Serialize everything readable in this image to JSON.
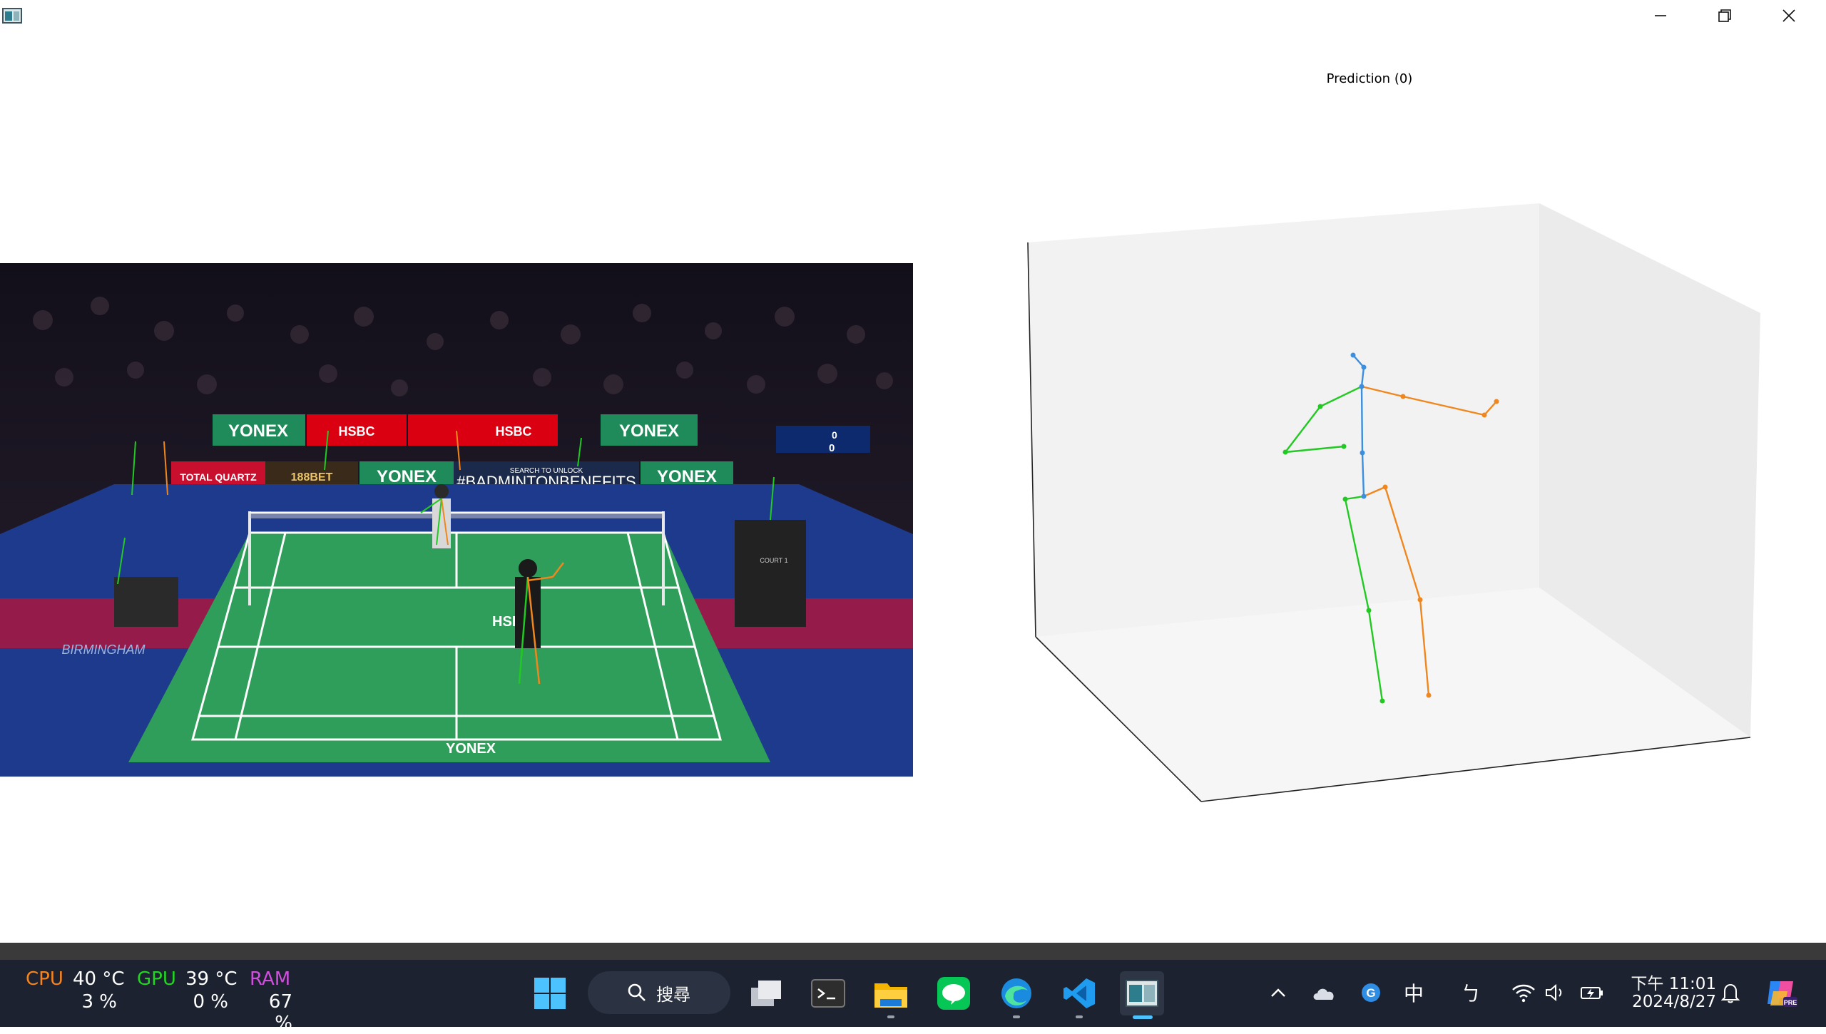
{
  "window": {
    "plot_title": "Prediction (0)"
  },
  "video": {
    "sponsor_1": "YONEX",
    "sponsor_2": "HSBC",
    "hashtag": "#BADMINTONBENEFITS",
    "search_text": "SEARCH TO UNLOCK",
    "sponsor_3": "TOTAL QUARTZ",
    "sponsor_4": "188BET",
    "venue": "BIRMINGHAM",
    "court_label": "COURT 1",
    "score_top": "0",
    "score_bottom": "0"
  },
  "skeleton_colors": {
    "spine": "#3b8fde",
    "left": "#22c922",
    "right": "#f0871e"
  },
  "taskbar": {
    "cpu_label": "CPU",
    "cpu_temp": "40 °C",
    "cpu_load": "3 %",
    "gpu_label": "GPU",
    "gpu_temp": "39 °C",
    "gpu_load": "0 %",
    "ram_label": "RAM",
    "ram_load": "67 %",
    "search_label": "搜尋",
    "ime": "中",
    "ime2": "ㄅ",
    "clock_time": "下午 11:01",
    "clock_date": "2024/8/27",
    "colors": {
      "cpu": "#f5841f",
      "gpu": "#22d622",
      "ram": "#d04fdc"
    }
  }
}
